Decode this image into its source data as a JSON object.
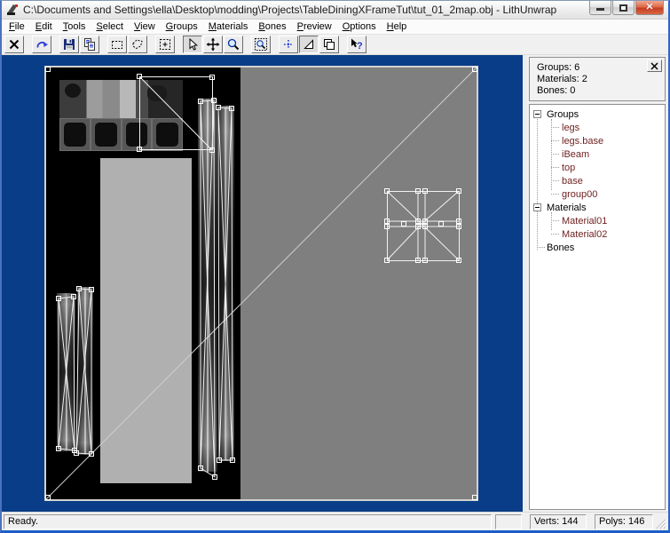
{
  "window": {
    "title": "C:\\Documents and Settings\\ella\\Desktop\\modding\\Projects\\TableDiningXFrameTut\\tut_01_2map.obj - LithUnwrap",
    "controls": {
      "minimize": "minimize",
      "maximize": "maximize",
      "close": "close"
    }
  },
  "menu": {
    "items": [
      "File",
      "Edit",
      "Tools",
      "Select",
      "View",
      "Groups",
      "Materials",
      "Bones",
      "Preview",
      "Options",
      "Help"
    ]
  },
  "toolbar": {
    "buttons": [
      {
        "name": "delete",
        "pressed": false
      },
      {
        "name": "redo",
        "pressed": false
      },
      {
        "name": "save",
        "pressed": false
      },
      {
        "name": "copy",
        "pressed": false
      },
      {
        "name": "select-rectangle",
        "pressed": false
      },
      {
        "name": "select-free",
        "pressed": false
      },
      {
        "name": "select-expand",
        "pressed": false
      },
      {
        "name": "pointer",
        "pressed": true
      },
      {
        "name": "move",
        "pressed": false
      },
      {
        "name": "zoom",
        "pressed": false
      },
      {
        "name": "zoom-region",
        "pressed": false
      },
      {
        "name": "vertex-mode",
        "pressed": false
      },
      {
        "name": "face-mode",
        "pressed": true
      },
      {
        "name": "arrange",
        "pressed": false
      },
      {
        "name": "context-help",
        "pressed": false
      }
    ]
  },
  "panel": {
    "stats": {
      "groups": "Groups: 6",
      "materials": "Materials: 2",
      "bones": "Bones: 0"
    },
    "tree": {
      "items": [
        {
          "label": "Groups",
          "type": "root"
        },
        {
          "label": "legs",
          "type": "child"
        },
        {
          "label": "legs.base",
          "type": "child"
        },
        {
          "label": "iBeam",
          "type": "child"
        },
        {
          "label": "top",
          "type": "child"
        },
        {
          "label": "base",
          "type": "child"
        },
        {
          "label": "group00",
          "type": "child"
        },
        {
          "label": "Materials",
          "type": "root"
        },
        {
          "label": "Material01",
          "type": "child"
        },
        {
          "label": "Material02",
          "type": "child"
        },
        {
          "label": "Bones",
          "type": "root-leaf"
        }
      ]
    }
  },
  "statusbar": {
    "ready": "Ready.",
    "verts": "Verts: 144",
    "polys": "Polys: 146"
  },
  "colors": {
    "canvas_bg": "#0a3d87",
    "uv_bg": "#7f7f7f",
    "texture_bg": "#000000",
    "wireframe": "#f2f2f2",
    "tree_child_text": "#6e1e1e",
    "window_frame_bottom": "#1d5ec9"
  }
}
